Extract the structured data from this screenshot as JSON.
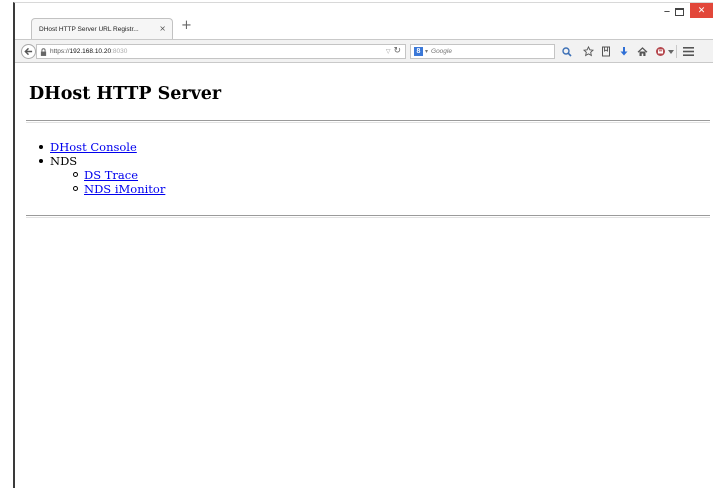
{
  "browser": {
    "tab": {
      "title": "DHost HTTP Server URL Registr...",
      "close_symbol": "×"
    },
    "new_tab_symbol": "+",
    "window_controls": {
      "minimize_symbol": "–",
      "close_symbol": "✕"
    },
    "address_bar": {
      "scheme": "https://",
      "host": "192.168.10.20",
      "port": ":8030"
    },
    "search_bar": {
      "engine_label": "8",
      "placeholder": "Google"
    },
    "toolbar_icons": [
      "search-icon",
      "bookmark-star-icon",
      "reading-list-icon",
      "download-icon",
      "home-icon",
      "extension-icon",
      "overflow-dropdown-icon",
      "hamburger-menu-icon"
    ],
    "colors": {
      "accent_blue": "#3b78d8",
      "close_red": "#e2473a"
    }
  },
  "page": {
    "title": "DHost HTTP Server",
    "links": [
      {
        "label": "DHost Console"
      },
      {
        "label": "NDS",
        "children": [
          {
            "label": "DS Trace"
          },
          {
            "label": "NDS iMonitor"
          }
        ]
      }
    ],
    "link_color": "#0000ee"
  }
}
